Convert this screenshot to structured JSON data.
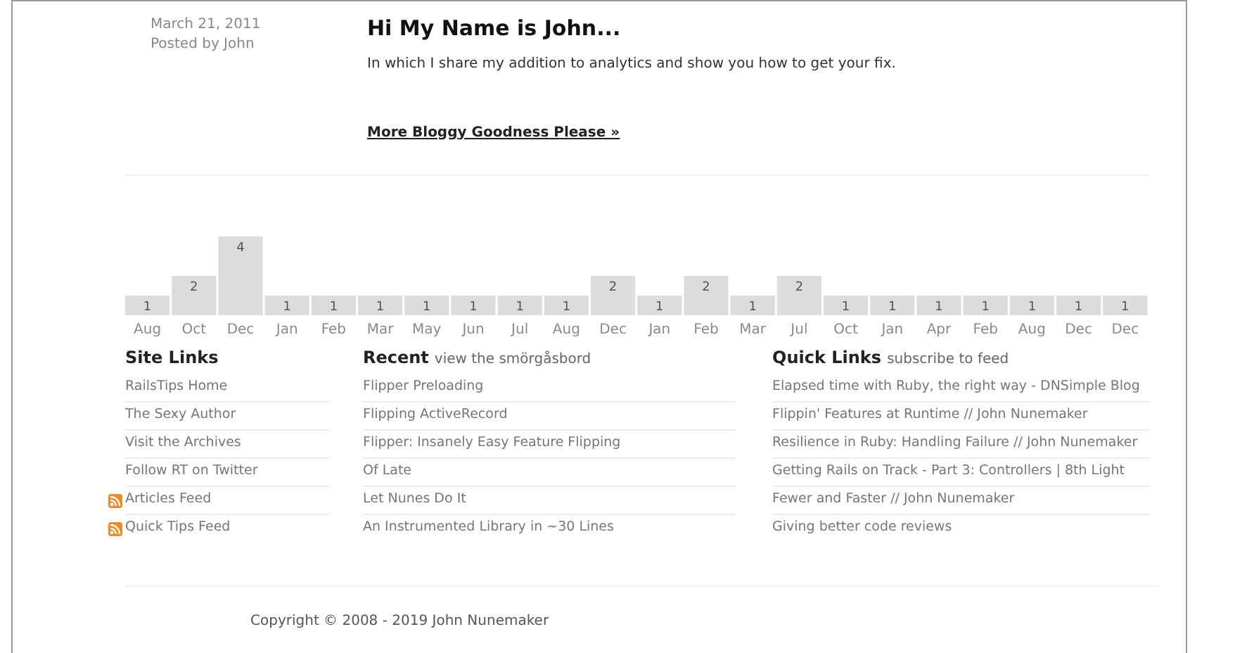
{
  "post": {
    "date": "March 21, 2011",
    "author": "Posted by John",
    "title": "Hi My Name is John...",
    "summary": "In which I share my addition to analytics and show you how to get your fix.",
    "more_link": "More Bloggy Goodness Please »"
  },
  "archive_chart": {
    "chart_data": {
      "type": "bar",
      "data_labels": true,
      "categories": [
        "Aug",
        "Oct",
        "Dec",
        "Jan",
        "Feb",
        "Mar",
        "May",
        "Jun",
        "Jul",
        "Aug",
        "Dec",
        "Jan",
        "Feb",
        "Mar",
        "Jul",
        "Oct",
        "Jan",
        "Apr",
        "Feb",
        "Aug",
        "Dec",
        "Dec"
      ],
      "values": [
        1,
        2,
        4,
        1,
        1,
        1,
        1,
        1,
        1,
        1,
        2,
        1,
        2,
        1,
        2,
        1,
        1,
        1,
        1,
        1,
        1,
        1
      ]
    }
  },
  "site_links": {
    "title": "Site Links",
    "items": [
      {
        "label": "RailsTips Home",
        "kind": "link"
      },
      {
        "label": "The Sexy Author",
        "kind": "link"
      },
      {
        "label": "Visit the Archives",
        "kind": "link"
      },
      {
        "label": "Follow RT on Twitter",
        "kind": "link"
      },
      {
        "label": "Articles Feed",
        "kind": "feed"
      },
      {
        "label": "Quick Tips Feed",
        "kind": "feed"
      }
    ]
  },
  "recent": {
    "title": "Recent",
    "subtitle": "view the smörgåsbord",
    "items": [
      "Flipper Preloading",
      "Flipping ActiveRecord",
      "Flipper: Insanely Easy Feature Flipping",
      "Of Late",
      "Let Nunes Do It",
      "An Instrumented Library in ~30 Lines"
    ]
  },
  "quick_links": {
    "title": "Quick Links",
    "subtitle": "subscribe to feed",
    "items": [
      "Elapsed time with Ruby, the right way - DNSimple Blog",
      "Flippin' Features at Runtime // John Nunemaker",
      "Resilience in Ruby: Handling Failure // John Nunemaker",
      "Getting Rails on Track - Part 3: Controllers | 8th Light",
      "Fewer and Faster // John Nunemaker",
      "Giving better code reviews"
    ]
  },
  "footer": {
    "copyright": "Copyright © 2008 - 2019 John Nunemaker"
  }
}
